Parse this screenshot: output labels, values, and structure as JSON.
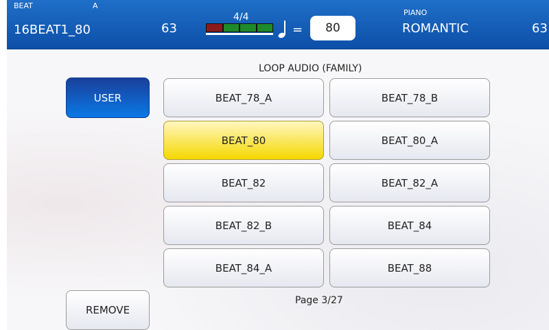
{
  "status": {
    "style_label": "BEAT",
    "variation": "A",
    "style_name": "16BEAT1_80",
    "style_value": "63",
    "time_signature": "4/4",
    "equals": "=",
    "tempo": "80",
    "voice_label": "PIANO",
    "voice_name": "ROMANTIC",
    "voice_value": "63"
  },
  "meter_colors": [
    "#8b1a1a",
    "#1e8a2a",
    "#1e8a2a",
    "#1e8a2a"
  ],
  "user_label": "USER",
  "list_title": "LOOP AUDIO (FAMILY)",
  "items": [
    {
      "label": "BEAT_78_A",
      "selected": false
    },
    {
      "label": "BEAT_78_B",
      "selected": false
    },
    {
      "label": "BEAT_80",
      "selected": true
    },
    {
      "label": "BEAT_80_A",
      "selected": false
    },
    {
      "label": "BEAT_82",
      "selected": false
    },
    {
      "label": "BEAT_82_A",
      "selected": false
    },
    {
      "label": "BEAT_82_B",
      "selected": false
    },
    {
      "label": "BEAT_84",
      "selected": false
    },
    {
      "label": "BEAT_84_A",
      "selected": false
    },
    {
      "label": "BEAT_88",
      "selected": false
    }
  ],
  "remove_label": "REMOVE",
  "page_label": "Page 3/27"
}
